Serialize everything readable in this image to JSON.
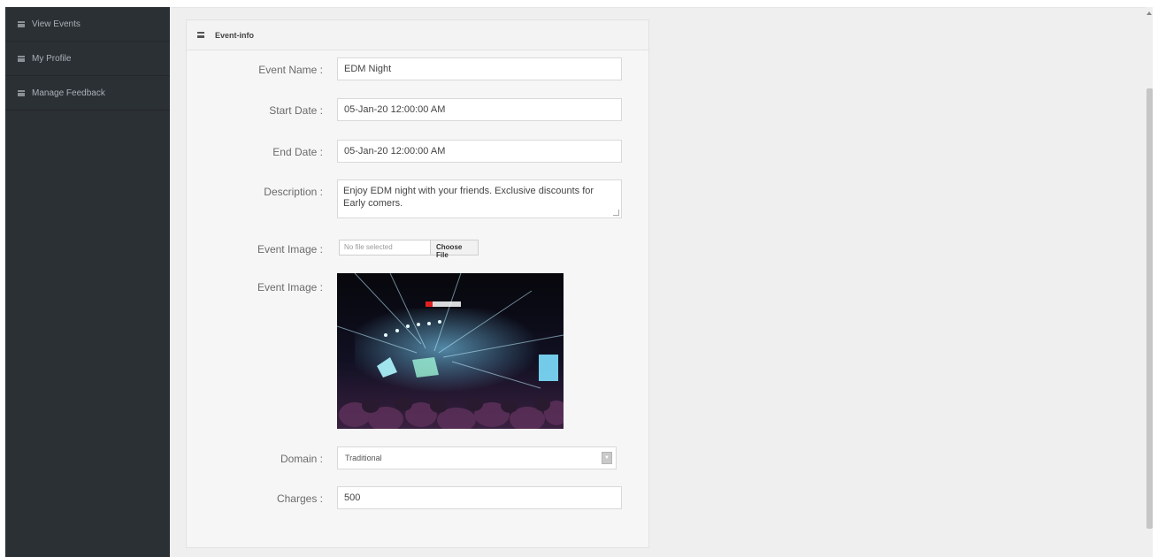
{
  "sidebar": {
    "items": [
      {
        "label": "View Events",
        "icon": "list-icon"
      },
      {
        "label": "My Profile",
        "icon": "list-icon"
      },
      {
        "label": "Manage Feedback",
        "icon": "list-icon"
      }
    ]
  },
  "panel": {
    "title": "Event-info",
    "event_name": {
      "label": "Event Name :",
      "value": "EDM Night"
    },
    "start_date": {
      "label": "Start Date :",
      "value": "05-Jan-20 12:00:00 AM"
    },
    "end_date": {
      "label": "End Date :",
      "value": "05-Jan-20 12:00:00 AM"
    },
    "description": {
      "label": "Description :",
      "value": "Enjoy EDM night with your friends. Exclusive discounts for Early comers."
    },
    "event_image_upload": {
      "label": "Event Image :",
      "no_file": "No file selected",
      "button": "Choose File"
    },
    "event_image_preview": {
      "label": "Event Image :"
    },
    "domain": {
      "label": "Domain :",
      "value": "Traditional"
    },
    "charges": {
      "label": "Charges :",
      "value": "500"
    }
  },
  "colors": {
    "sidebar_bg": "#2b3035",
    "main_bg": "#efefef",
    "panel_bg": "#f6f6f6"
  }
}
